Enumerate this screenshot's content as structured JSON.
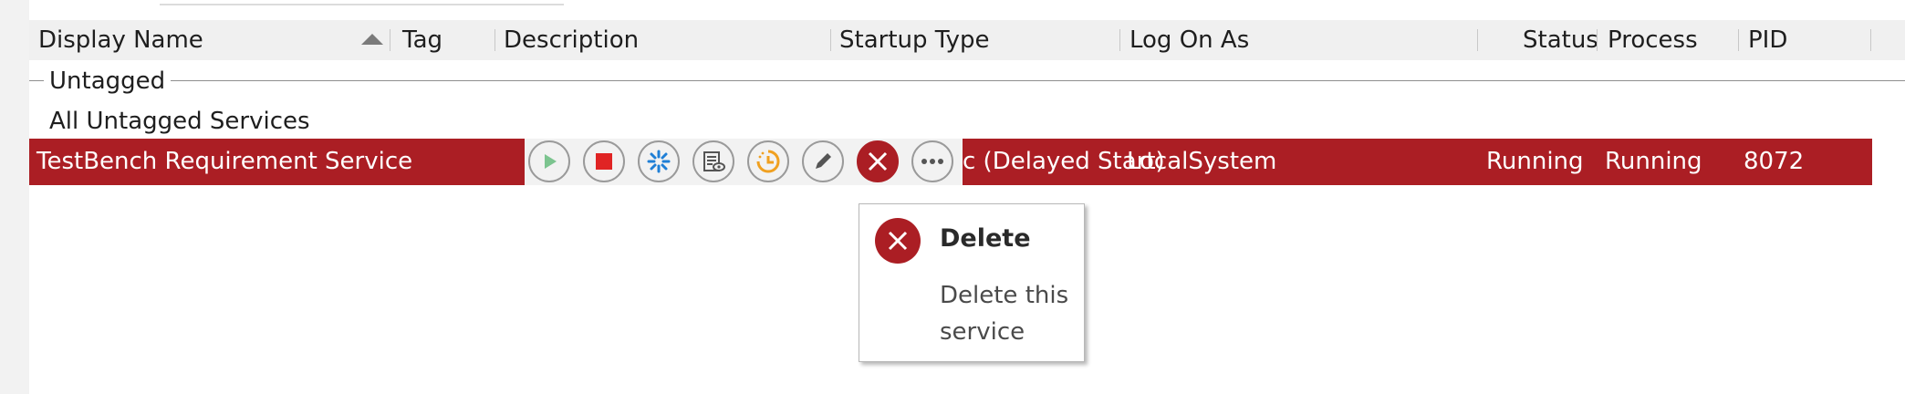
{
  "columns": {
    "display_name": "Display Name",
    "tag": "Tag",
    "description": "Description",
    "startup_type": "Startup Type",
    "log_on_as": "Log On As",
    "status": "Status",
    "process": "Process",
    "pid": "PID"
  },
  "group": {
    "label": "Untagged",
    "sub_label": "All Untagged Services"
  },
  "row": {
    "display_name": "TestBench Requirement Service",
    "startup_type_visible": "c (Delayed Start)",
    "log_on_as": "LocalSystem",
    "status": "Running",
    "process": "Running",
    "pid": "8072"
  },
  "actions": [
    {
      "name": "start",
      "icon": "play-icon",
      "color": "#7cc48f"
    },
    {
      "name": "stop",
      "icon": "stop-icon",
      "color": "#e02424"
    },
    {
      "name": "restart",
      "icon": "spinner-icon",
      "color": "#1f7fd6"
    },
    {
      "name": "logs",
      "icon": "log-icon",
      "color": "#555555"
    },
    {
      "name": "schedule",
      "icon": "clock-icon",
      "color": "#f0a020"
    },
    {
      "name": "edit",
      "icon": "pencil-icon",
      "color": "#555555"
    },
    {
      "name": "delete",
      "icon": "close-icon",
      "color": "#ab1e24"
    },
    {
      "name": "more",
      "icon": "ellipsis-icon",
      "color": "#555555"
    }
  ],
  "tooltip": {
    "title": "Delete",
    "description": "Delete this service"
  },
  "colors": {
    "selection": "#ab1e24",
    "header_bg": "#f0f0f0"
  }
}
